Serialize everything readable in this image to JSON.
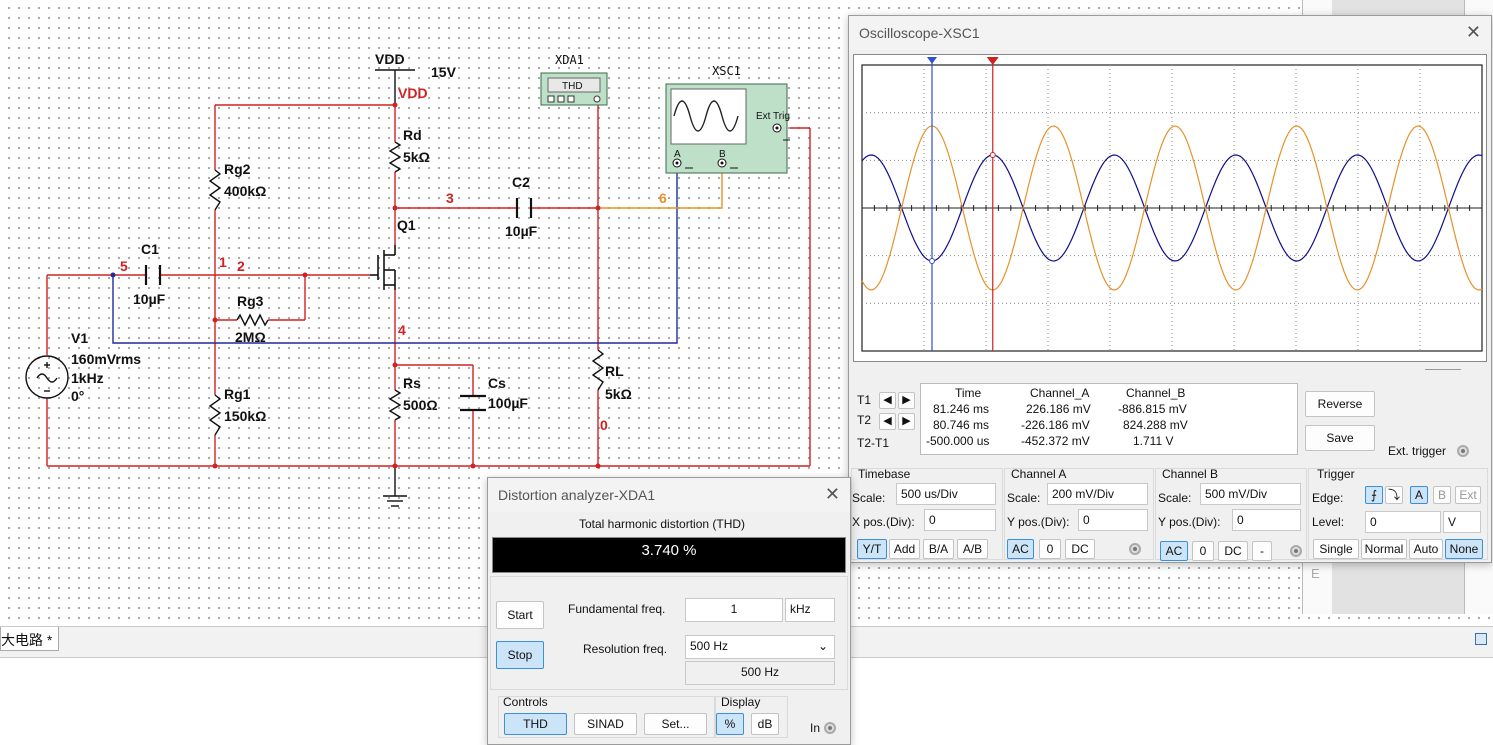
{
  "schematic": {
    "vdd_symbol": "VDD",
    "vdd_value": "15V",
    "vdd_net": "VDD",
    "xda1": "XDA1",
    "thd_label": "THD",
    "xsc1": "XSC1",
    "ext_trig": "Ext Trig",
    "scope_a": "A",
    "scope_b": "B",
    "rd_name": "Rd",
    "rd_val": "5kΩ",
    "rg2_name": "Rg2",
    "rg2_val": "400kΩ",
    "rg3_name": "Rg3",
    "rg3_val": "2MΩ",
    "rg1_name": "Rg1",
    "rg1_val": "150kΩ",
    "rs_name": "Rs",
    "rs_val": "500Ω",
    "cs_name": "Cs",
    "cs_val": "100µF",
    "rl_name": "RL",
    "rl_val": "5kΩ",
    "c1_name": "C1",
    "c1_val": "10µF",
    "c2_name": "C2",
    "c2_val": "10µF",
    "q1_name": "Q1",
    "v1_name": "V1",
    "v1_amp": "160mVrms",
    "v1_freq": "1kHz",
    "v1_phase": "0°",
    "nodes": {
      "n1": "1",
      "n2": "2",
      "n3": "3",
      "n4": "4",
      "n5": "5",
      "n6": "6",
      "n0": "0"
    }
  },
  "oscilloscope": {
    "title": "Oscilloscope-XSC1",
    "cursor_table": {
      "headers": [
        "Time",
        "Channel_A",
        "Channel_B"
      ],
      "rows": [
        {
          "label": "T1",
          "time": "81.246 ms",
          "a": "226.186 mV",
          "b": "-886.815 mV"
        },
        {
          "label": "T2",
          "time": "80.746 ms",
          "a": "-226.186 mV",
          "b": "824.288 mV"
        },
        {
          "label": "T2-T1",
          "time": "-500.000 us",
          "a": "-452.372 mV",
          "b": "1.711 V"
        }
      ]
    },
    "reverse_label": "Reverse",
    "save_label": "Save",
    "ext_trigger_label": "Ext. trigger",
    "timebase": {
      "title": "Timebase",
      "scale_label": "Scale:",
      "scale": "500 us/Div",
      "xpos_label": "X pos.(Div):",
      "xpos": "0",
      "buttons": [
        "Y/T",
        "Add",
        "B/A",
        "A/B"
      ]
    },
    "channel_a": {
      "title": "Channel A",
      "scale_label": "Scale:",
      "scale": "200 mV/Div",
      "ypos_label": "Y pos.(Div):",
      "ypos": "0",
      "buttons": [
        "AC",
        "0",
        "DC"
      ]
    },
    "channel_b": {
      "title": "Channel B",
      "scale_label": "Scale:",
      "scale": "500 mV/Div",
      "ypos_label": "Y pos.(Div):",
      "ypos": "0",
      "buttons": [
        "AC",
        "0",
        "DC",
        "-"
      ]
    },
    "trigger": {
      "title": "Trigger",
      "edge_label": "Edge:",
      "level_label": "Level:",
      "level": "0",
      "level_unit": "V",
      "sources": [
        "A",
        "B",
        "Ext"
      ],
      "modes": [
        "Single",
        "Normal",
        "Auto",
        "None"
      ]
    },
    "colors": {
      "channel_a": "#0f0f8c",
      "channel_b": "#e8912a",
      "cursor_t1": "#d02020",
      "cursor_t2": "#3050d0"
    }
  },
  "distortion": {
    "title": "Distortion analyzer-XDA1",
    "thd_header": "Total harmonic distortion (THD)",
    "thd_value": "3.740 %",
    "start_label": "Start",
    "stop_label": "Stop",
    "fund_label": "Fundamental freq.",
    "fund_value": "1",
    "fund_unit": "kHz",
    "res_label": "Resolution freq.",
    "res_value": "500 Hz",
    "res_readout": "500 Hz",
    "controls_label": "Controls",
    "thd_btn": "THD",
    "sinad_btn": "SINAD",
    "set_btn": "Set...",
    "display_label": "Display",
    "pct_btn": "%",
    "db_btn": "dB",
    "in_label": "In"
  },
  "tabs": {
    "active": "大电路 *"
  }
}
